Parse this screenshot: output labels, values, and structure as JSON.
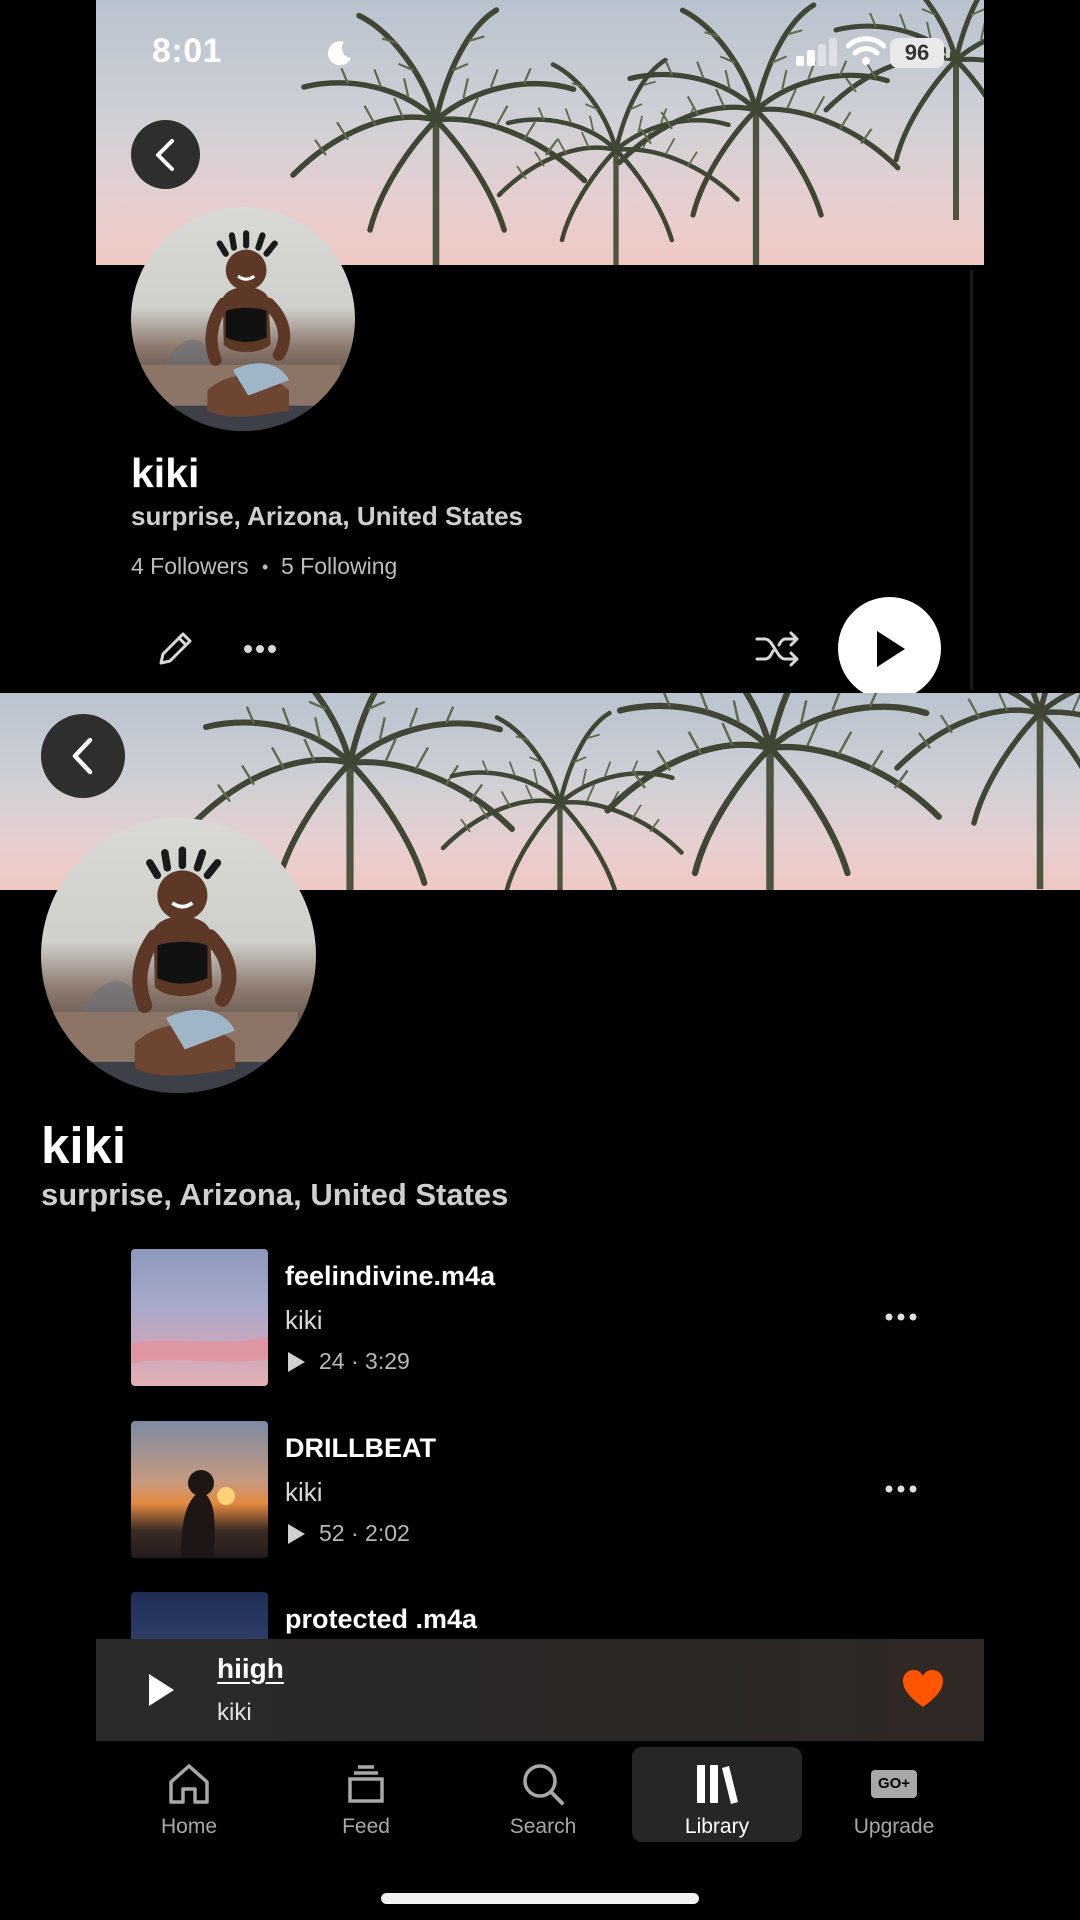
{
  "status_bar": {
    "time": "8:01",
    "battery": "96",
    "icons": [
      "moon-icon",
      "cellular-signal-icon",
      "wifi-icon",
      "battery-icon"
    ]
  },
  "profile": {
    "name": "kiki",
    "location": "surprise, Arizona, United States",
    "followers": "4 Followers",
    "separator": "•",
    "following": "5 Following"
  },
  "action_row": {
    "icons": [
      "edit-pencil-icon",
      "more-dots-icon",
      "shuffle-icon",
      "play-icon"
    ]
  },
  "tracks": [
    {
      "title": "feelindivine.m4a",
      "artist": "kiki",
      "plays": "24 · 3:29"
    },
    {
      "title": "DRILLBEAT",
      "artist": "kiki",
      "plays": "52 · 2:02"
    },
    {
      "title": "protected .m4a"
    }
  ],
  "mini_player": {
    "title": "hiigh",
    "artist": "kiki",
    "liked": true
  },
  "nav": {
    "tabs": [
      {
        "label": "Home",
        "icon": "home-icon"
      },
      {
        "label": "Feed",
        "icon": "feed-stack-icon"
      },
      {
        "label": "Search",
        "icon": "search-icon"
      },
      {
        "label": "Library",
        "icon": "library-icon",
        "active": true
      },
      {
        "label": "Upgrade",
        "icon": "go-plus-icon",
        "badge": "GO+"
      }
    ]
  },
  "colors": {
    "background": "#000000",
    "accent_heart": "#ff5500",
    "active_tab_bg": "#262626"
  }
}
